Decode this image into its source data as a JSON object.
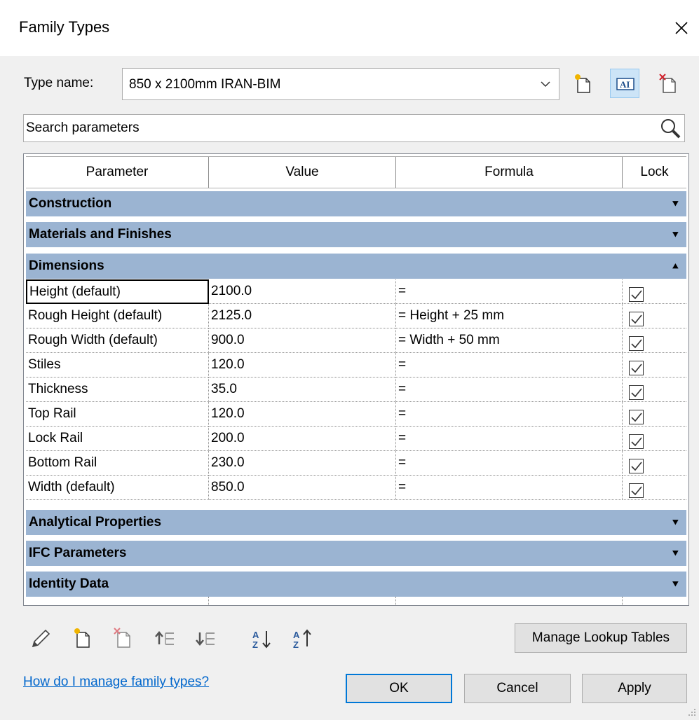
{
  "window": {
    "title": "Family Types"
  },
  "type_name": {
    "label": "Type name:",
    "value": "850 x 2100mm IRAN-BIM"
  },
  "search": {
    "placeholder": "Search parameters"
  },
  "columns": [
    "Parameter",
    "Value",
    "Formula",
    "Lock"
  ],
  "groups": {
    "construction": {
      "label": "Construction",
      "state": "collapsed"
    },
    "materials": {
      "label": "Materials and Finishes",
      "state": "collapsed"
    },
    "dimensions": {
      "label": "Dimensions",
      "state": "expanded"
    },
    "analytical": {
      "label": "Analytical Properties",
      "state": "collapsed"
    },
    "ifc": {
      "label": "IFC Parameters",
      "state": "collapsed"
    },
    "identity": {
      "label": "Identity Data",
      "state": "collapsed"
    }
  },
  "rows": [
    {
      "parameter": "Height (default)",
      "value": "2100.0",
      "formula": "=",
      "lock": true
    },
    {
      "parameter": "Rough Height (default)",
      "value": "2125.0",
      "formula": "= Height + 25 mm",
      "lock": true
    },
    {
      "parameter": "Rough Width (default)",
      "value": "900.0",
      "formula": "= Width + 50 mm",
      "lock": true
    },
    {
      "parameter": "Stiles",
      "value": "120.0",
      "formula": "=",
      "lock": true
    },
    {
      "parameter": "Thickness",
      "value": "35.0",
      "formula": "=",
      "lock": true
    },
    {
      "parameter": "Top Rail",
      "value": "120.0",
      "formula": "=",
      "lock": true
    },
    {
      "parameter": "Lock Rail",
      "value": "200.0",
      "formula": "=",
      "lock": true
    },
    {
      "parameter": "Bottom Rail",
      "value": "230.0",
      "formula": "=",
      "lock": true
    },
    {
      "parameter": "Width (default)",
      "value": "850.0",
      "formula": "=",
      "lock": true
    }
  ],
  "footer": {
    "manage_lookup": "Manage Lookup Tables",
    "help_link": "How do I manage family types?",
    "ok": "OK",
    "cancel": "Cancel",
    "apply": "Apply"
  },
  "colors": {
    "group_header": "#9bb4d2",
    "link": "#0066cc",
    "default_button_border": "#0078d7"
  }
}
